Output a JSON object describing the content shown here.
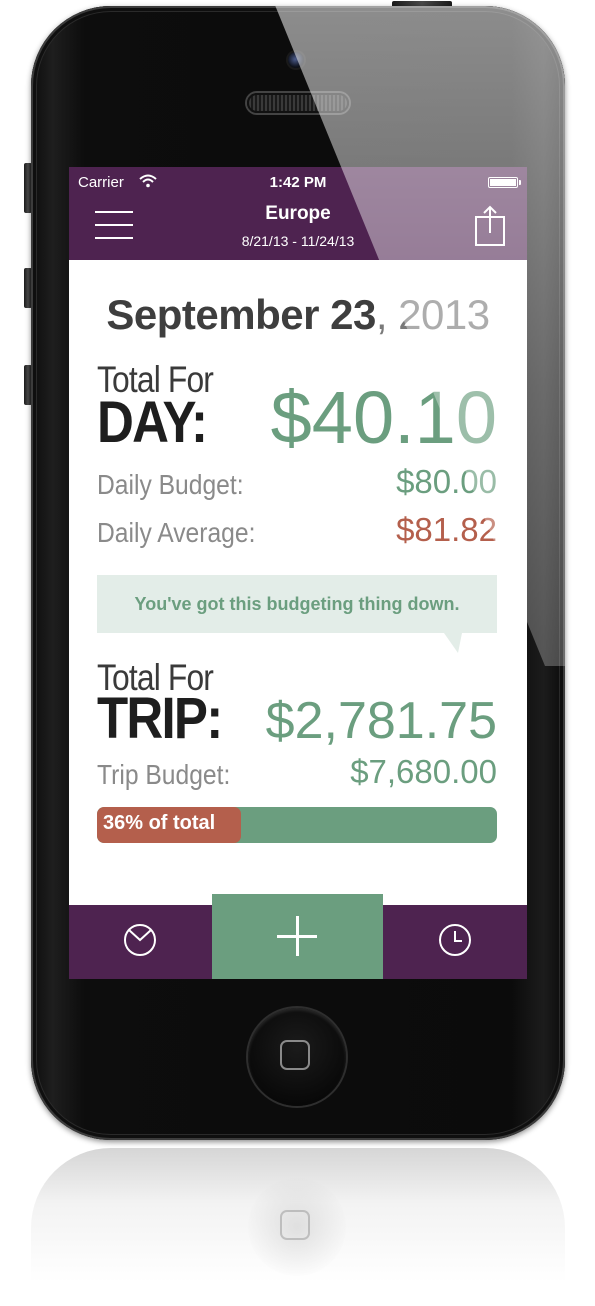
{
  "status_bar": {
    "carrier": "Carrier",
    "time": "1:42 PM"
  },
  "nav": {
    "title": "Europe",
    "date_range": "8/21/13 - 11/24/13"
  },
  "date": {
    "month_day": "September 23",
    "year": ", 2013"
  },
  "day": {
    "prefix": "Total For",
    "label": "DAY:",
    "total": "$40.10",
    "daily_budget_label": "Daily Budget:",
    "daily_budget": "$80.00",
    "daily_average_label": "Daily Average:",
    "daily_average": "$81.82"
  },
  "message": "You've got this budgeting thing down.",
  "trip": {
    "prefix": "Total For",
    "label": "TRIP:",
    "total": "$2,781.75",
    "budget_label": "Trip Budget:",
    "budget": "$7,680.00",
    "progress_label": "36% of total",
    "progress_fraction": 0.36
  },
  "tabs": [
    {
      "name": "stats",
      "icon": "pie-chart-icon"
    },
    {
      "name": "add",
      "icon": "plus-icon"
    },
    {
      "name": "history",
      "icon": "clock-icon"
    }
  ],
  "colors": {
    "brand_purple": "#4e2350",
    "accent_green": "#6b9e7f",
    "warning_red": "#b45f4c"
  }
}
